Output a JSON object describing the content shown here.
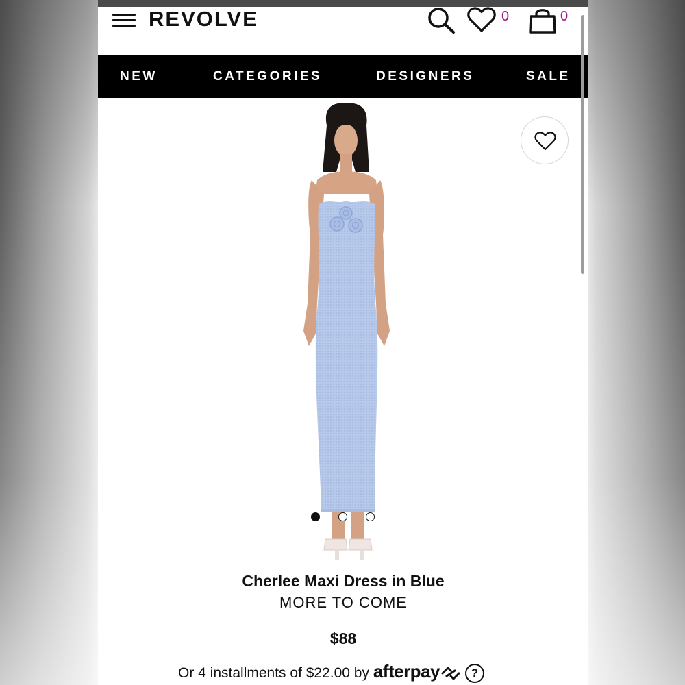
{
  "header": {
    "logo": "REVOLVE",
    "wishlist_count": "0",
    "bag_count": "0",
    "icons": [
      "menu-icon",
      "search-icon",
      "heart-icon",
      "shopping-bag-icon"
    ],
    "count_color": "#a3168a"
  },
  "nav": {
    "items": [
      "NEW",
      "CATEGORIES",
      "DESIGNERS",
      "SALE"
    ]
  },
  "gallery": {
    "image_count": 3,
    "active_index": 0,
    "favorite_icon": "heart-outline-icon"
  },
  "product": {
    "name": "Cherlee Maxi Dress in Blue",
    "brand": "MORE TO COME",
    "price": "$88",
    "installments_text": "Or 4 installments of $22.00 by",
    "afterpay_label": "afterpay",
    "help_label": "?"
  },
  "colors": {
    "nav_background": "#000000",
    "dress": "#b6c8ea"
  }
}
